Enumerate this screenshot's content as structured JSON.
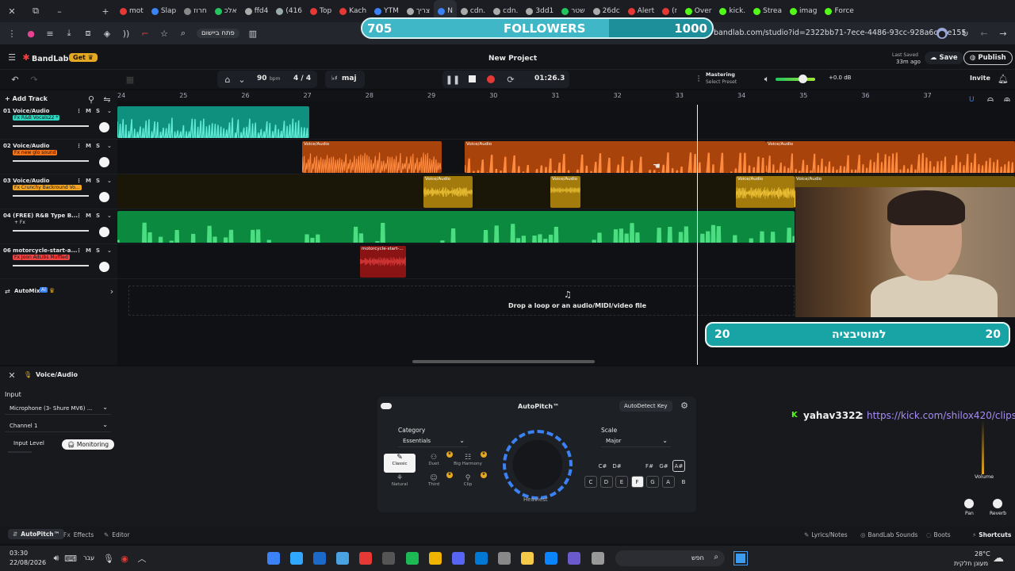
{
  "browser": {
    "tabs": [
      "mot",
      "Slap",
      "חרוז",
      "אלכ",
      "ffd4",
      "(416",
      "Top",
      "Kach",
      "YTM",
      "צריך",
      "N",
      "cdn.",
      "cdn.",
      "3dd1",
      "שטר",
      "26dc",
      "Alert",
      "(ז",
      "Over",
      "kick.",
      "Strea",
      "imag",
      "Force"
    ],
    "url": "bandlab.com/studio?id=2322bb71-7ece-4486-93cc-928a6ca5e155",
    "toolbar_chip": "פתח ביישום"
  },
  "followers_widget": {
    "current": "705",
    "label": "FOLLOWERS",
    "goal": "1000",
    "progress_percent": 70.5
  },
  "app": {
    "brand": "BandLab",
    "get_label": "Get",
    "project_title": "New Project",
    "last_saved_label": "Last Saved",
    "last_saved_time": "33m ago",
    "save_label": "Save",
    "publish_label": "Publish",
    "invite_label": "Invite",
    "mastering_label": "Mastering",
    "mastering_sub": "Select Preset",
    "output_db": "+0.0 dB"
  },
  "transport": {
    "bpm": "90",
    "bpm_unit": "bpm",
    "time_sig": "4 / 4",
    "key": "maj",
    "time": "01:26.3"
  },
  "ruler": [
    "24",
    "25",
    "26",
    "27",
    "28",
    "29",
    "30",
    "31",
    "32",
    "33",
    "34",
    "35",
    "36",
    "37"
  ],
  "add_track_label": "Add Track",
  "tracks": [
    {
      "name": "01  Voice/Audio",
      "fx": "Fx R&B Vocals22 *",
      "fx_color": "#2dd4bf"
    },
    {
      "name": "02  Voice/Audio",
      "fx": "Fx new glo sound",
      "fx_color": "#f97316"
    },
    {
      "name": "03  Voice/Audio",
      "fx": "Fx Crunchy Backround Vo...",
      "fx_color": "#f5a524"
    },
    {
      "name": "04  (FREE) R&B Type B...",
      "fx": "+ Fx",
      "fx_color": "#14161a"
    },
    {
      "name": "06  motorcycle-start-a...",
      "fx": "Fx Joon AdLibs Muffled",
      "fx_color": "#ef4444"
    }
  ],
  "track_mute": "M",
  "track_solo": "S",
  "clip_labels": {
    "voice": "Voice/Audio",
    "moto": "motorcycle-start-..."
  },
  "automix_label": "AutoMix",
  "automix_badge": "AI",
  "drop_text": "Drop a loop or an audio/MIDI/video file",
  "motivation_widget": {
    "left": "20",
    "text": "למוטיבציה",
    "right": "20"
  },
  "chat": {
    "user": "yahav3322",
    "sep": ":",
    "link": "https://kick.com/shilox420/clips"
  },
  "bottom_panel": {
    "title": "Voice/Audio",
    "input_label": "Input",
    "input_device": "Microphone (3- Shure MV6) ...",
    "channel": "Channel 1",
    "input_level_label": "Input Level",
    "monitoring_label": "Monitoring",
    "volume_label": "Volume",
    "pan_label": "Pan",
    "reverb_label": "Reverb"
  },
  "autopitch": {
    "title": "AutoPitch™",
    "autodetect_label": "AutoDetect Key",
    "category_label": "Category",
    "category_value": "Essentials",
    "scale_label": "Scale",
    "scale_value": "Major",
    "knob_label": "Heaviest",
    "presets": [
      "Classic",
      "Duet",
      "Big Harmony",
      "Natural",
      "Third",
      "Clip"
    ],
    "sharps": [
      "C#",
      "D#",
      "F#",
      "G#",
      "A#"
    ],
    "naturals": [
      "C",
      "D",
      "E",
      "F",
      "G",
      "A",
      "B"
    ]
  },
  "bottom_tabs": {
    "left": [
      "AutoPitch™",
      "Effects",
      "Editor"
    ],
    "right": [
      "Lyrics/Notes",
      "BandLab Sounds",
      "Boots",
      "Shortcuts"
    ]
  },
  "taskbar": {
    "time": "03:30",
    "date": "22/08/2026",
    "lang": "עבר",
    "search": "חפש",
    "weather_temp": "28°C",
    "weather_text": "מעונן חלקית"
  }
}
